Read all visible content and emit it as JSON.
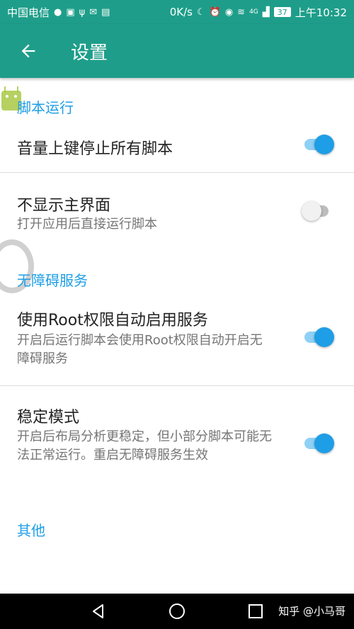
{
  "status_bar": {
    "carrier": "中国电信",
    "network_speed": "0K/s",
    "signal_text": "4G",
    "battery": "37",
    "time": "上午10:32"
  },
  "app_bar": {
    "title": "设置",
    "back_icon": "arrow-left-icon"
  },
  "sections": {
    "script_run": {
      "header": "脚本运行",
      "volume_stop": {
        "title": "音量上键停止所有脚本",
        "enabled": true
      },
      "hide_main": {
        "title": "不显示主界面",
        "summary": "打开应用后直接运行脚本",
        "enabled": false
      }
    },
    "accessibility": {
      "header": "无障碍服务",
      "root_enable": {
        "title": "使用Root权限自动启用服务",
        "summary": "开启后运行脚本会使用Root权限自动开启无障碍服务",
        "enabled": true
      },
      "stable_mode": {
        "title": "稳定模式",
        "summary": "开启后布局分析更稳定，但小部分脚本可能无法正常运行。重启无障碍服务生效",
        "enabled": true
      }
    },
    "other": {
      "header": "其他"
    }
  },
  "nav_bar": {
    "watermark": "知乎 @小马哥",
    "icons": [
      "back-triangle-icon",
      "home-circle-icon",
      "recents-square-icon"
    ]
  },
  "colors": {
    "primary": "#1e9e8a",
    "accent": "#1e9ee6",
    "switch_on_track": "#8fd0f5"
  }
}
